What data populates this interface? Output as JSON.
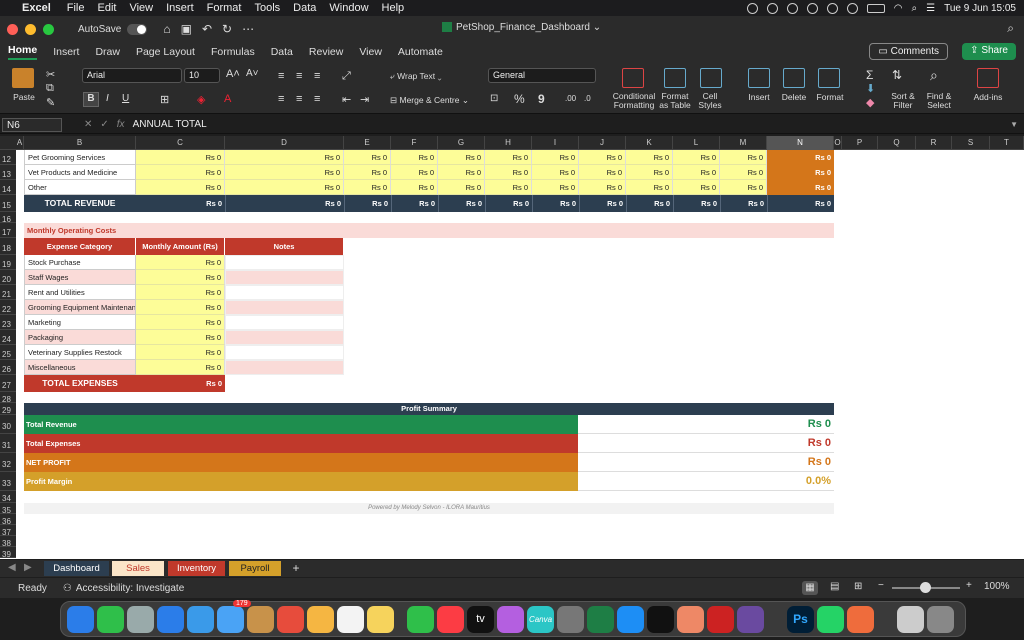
{
  "menubar": {
    "app": "Excel",
    "items": [
      "File",
      "Edit",
      "View",
      "Insert",
      "Format",
      "Tools",
      "Data",
      "Window",
      "Help"
    ],
    "datetime": "Tue 9 Jun  15:05"
  },
  "titlebar": {
    "autosave": "AutoSave",
    "title": "PetShop_Finance_Dashboard"
  },
  "ribbon_tabs": [
    "Home",
    "Insert",
    "Draw",
    "Page Layout",
    "Formulas",
    "Data",
    "Review",
    "View",
    "Automate"
  ],
  "comments_label": "Comments",
  "share_label": "Share",
  "ribbon": {
    "paste": "Paste",
    "font": "Arial",
    "size": "10",
    "wrap": "Wrap Text",
    "merge": "Merge & Centre",
    "numfmt": "General",
    "cond": "Conditional",
    "cond2": "Formatting",
    "fat": "Format",
    "fat2": "as Table",
    "cs": "Cell",
    "cs2": "Styles",
    "insert": "Insert",
    "delete": "Delete",
    "format": "Format",
    "sort": "Sort &",
    "sort2": "Filter",
    "find": "Find &",
    "find2": "Select",
    "addins": "Add-ins",
    "bold": "B",
    "italic": "I",
    "underline": "U",
    "percent": "%",
    "comma": "9",
    "dec_add": ".00",
    "dec_rem": ".0"
  },
  "formula_bar": {
    "cell": "N6",
    "fx": "fx",
    "value": "ANNUAL TOTAL"
  },
  "columns": [
    "A",
    "B",
    "C",
    "D",
    "E",
    "F",
    "G",
    "H",
    "I",
    "J",
    "K",
    "L",
    "M",
    "N",
    "O",
    "P",
    "Q",
    "R",
    "S",
    "T"
  ],
  "revenue_rows": [
    {
      "row": "12",
      "label": "Pet Grooming Services"
    },
    {
      "row": "13",
      "label": "Vet Products and Medicine"
    },
    {
      "row": "14",
      "label": "Other"
    }
  ],
  "zero": "Rs 0",
  "total_revenue": "TOTAL REVENUE",
  "opcosts_title": "Monthly Operating Costs",
  "exp_headers": [
    "Expense Category",
    "Monthly Amount (Rs)",
    "Notes"
  ],
  "expenses": [
    "Stock Purchase",
    "Staff Wages",
    "Rent and Utilities",
    "Grooming Equipment Maintenance",
    "Marketing",
    "Packaging",
    "Veterinary Supplies Restock",
    "Miscellaneous"
  ],
  "total_expenses": "TOTAL EXPENSES",
  "profit": {
    "title": "Profit Summary",
    "rows": [
      {
        "label": "Total Revenue",
        "value": "Rs 0",
        "color": "#1e8e4e"
      },
      {
        "label": "Total Expenses",
        "value": "Rs 0",
        "color": "#c0392b"
      },
      {
        "label": "NET PROFIT",
        "value": "Rs 0",
        "color": "#d4761a"
      },
      {
        "label": "Profit Margin",
        "value": "0.0%",
        "color": "#d4a02a"
      }
    ]
  },
  "footer": "Powered by Melody Selvon  -  ILORA Mauritius",
  "row_numbers": [
    "12",
    "13",
    "14",
    "15",
    "16",
    "17",
    "18",
    "19",
    "20",
    "21",
    "22",
    "23",
    "24",
    "25",
    "26",
    "27",
    "28",
    "29",
    "30",
    "31",
    "32",
    "33",
    "34",
    "35",
    "36",
    "37",
    "38",
    "39"
  ],
  "sheets": [
    {
      "name": "Dashboard",
      "bg": "#2c3e50",
      "fg": "#fff"
    },
    {
      "name": "Sales",
      "bg": "#fbe5c8",
      "fg": "#c0392b"
    },
    {
      "name": "Inventory",
      "bg": "#c0392b",
      "fg": "#fff"
    },
    {
      "name": "Payroll",
      "bg": "#d4a02a",
      "fg": "#222"
    }
  ],
  "add_sheet": "+",
  "status": {
    "ready": "Ready",
    "accessibility": "Accessibility: Investigate",
    "zoom": "100%"
  },
  "dock_badge": "179",
  "dock_labels": {
    "tv": "tv",
    "canva": "Canva",
    "ps": "Ps"
  }
}
